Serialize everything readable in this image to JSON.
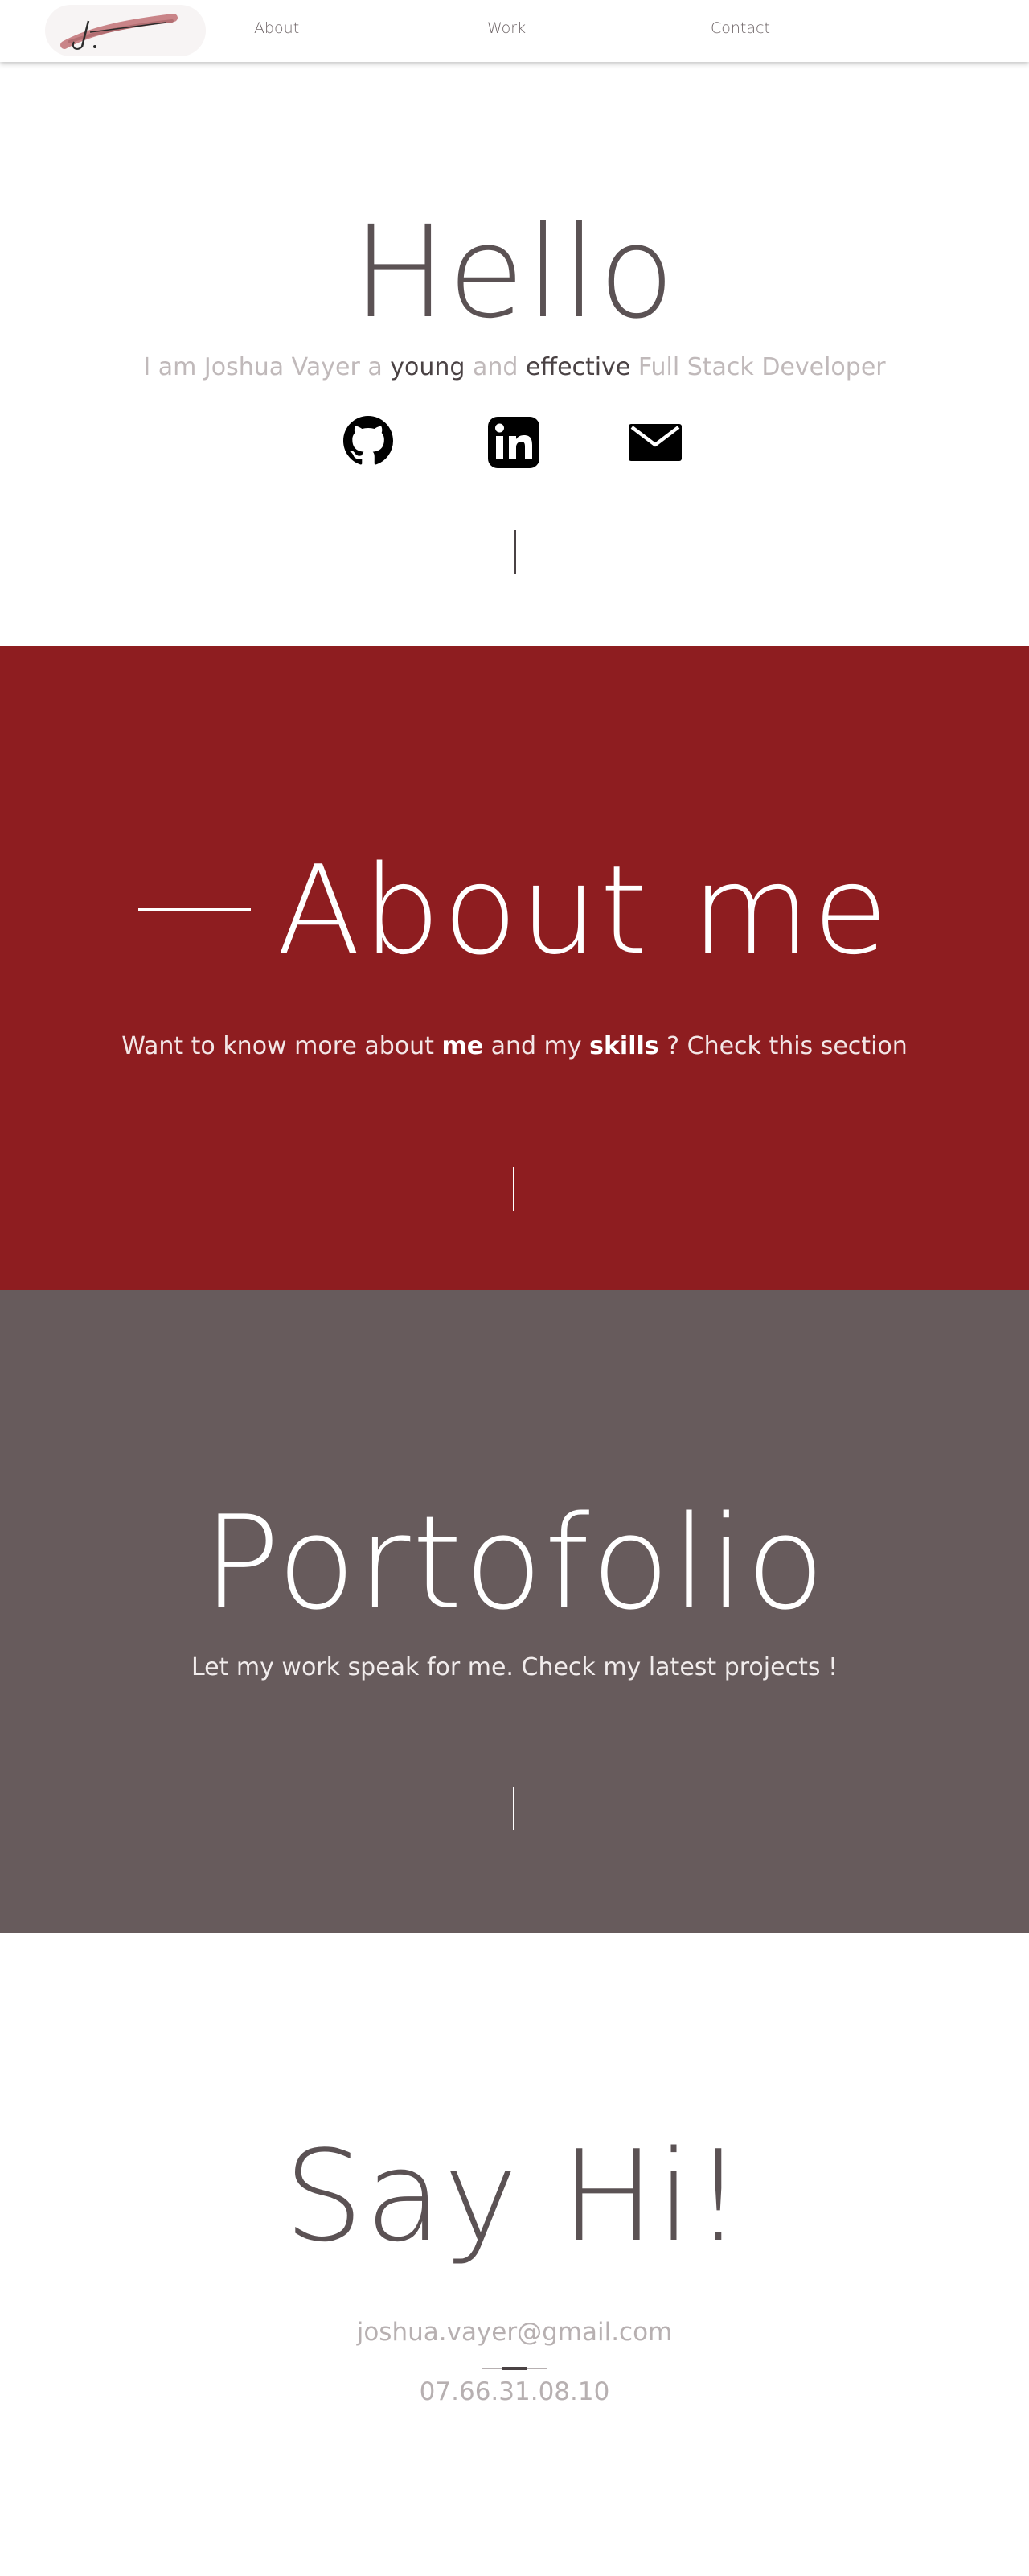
{
  "nav": {
    "logo_text": "J.",
    "items": [
      {
        "label": "About"
      },
      {
        "label": "Work"
      },
      {
        "label": "Contact"
      }
    ]
  },
  "hero": {
    "title": "Hello",
    "tagline": {
      "part1": "I am Joshua Vayer a ",
      "em1": "young",
      "part2": " and ",
      "em2": "effective",
      "part3": " Full Stack Developer"
    },
    "socials": [
      {
        "icon": "github-icon"
      },
      {
        "icon": "linkedin-icon"
      },
      {
        "icon": "mail-icon"
      }
    ]
  },
  "about": {
    "title": "About me",
    "tagline": {
      "part1": "Want to know more about ",
      "em1": "me",
      "part2": " and my ",
      "em2": "skills",
      "part3": " ? Check this section"
    },
    "background": "#8e1d20"
  },
  "work": {
    "title": "Portofolio",
    "tagline": "Let my work speak for me. Check my latest projects !",
    "background": "#675b5c"
  },
  "contact": {
    "title": "Say Hi!",
    "email": "joshua.vayer@gmail.com",
    "phone": "07.66.31.08.10"
  }
}
